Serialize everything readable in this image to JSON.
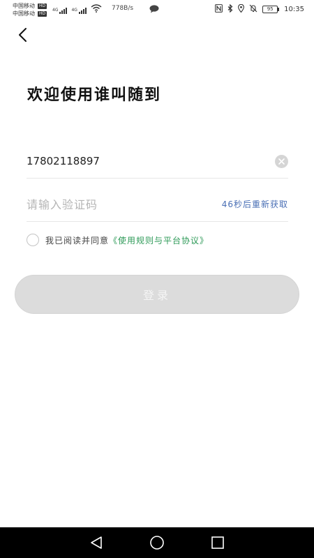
{
  "status_bar": {
    "carrier_1": "中国移动",
    "carrier_2": "中国移动",
    "hd_badge": "HD",
    "network_label": "4G",
    "net_speed": "778B/s",
    "battery": "95",
    "time": "10:35",
    "icons": [
      "nfc-icon",
      "bluetooth-icon",
      "location-icon",
      "mute-icon",
      "battery-icon",
      "wifi-icon",
      "message-icon"
    ]
  },
  "header": {
    "back_icon": "back-arrow-icon"
  },
  "welcome_title": "欢迎使用谁叫随到",
  "phone": {
    "value": "17802118897",
    "clear_icon": "clear-icon"
  },
  "code": {
    "placeholder": "请输入验证码",
    "resend_label": "46秒后重新获取"
  },
  "agreement": {
    "prefix": "我已阅读并同意",
    "link": "《使用规则与平台协议》"
  },
  "login_button": "登录",
  "colors": {
    "link_blue": "#4a6fb5",
    "agreement_green": "#2e9a58",
    "button_disabled": "#dcdcdc"
  },
  "nav": {
    "icons": [
      "nav-back-icon",
      "nav-home-icon",
      "nav-recents-icon"
    ]
  }
}
